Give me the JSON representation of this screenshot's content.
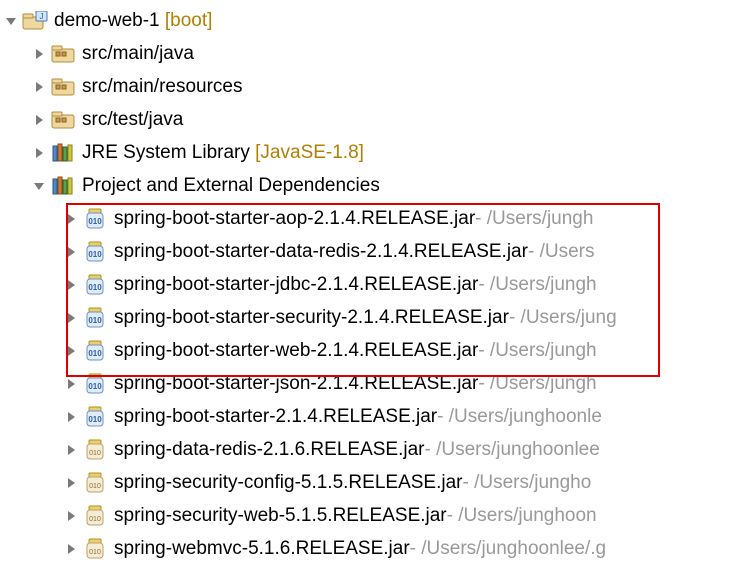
{
  "project": {
    "name": "demo-web-1",
    "qualifier": "[boot]"
  },
  "folders": [
    {
      "label": "src/main/java"
    },
    {
      "label": "src/main/resources"
    },
    {
      "label": "src/test/java"
    }
  ],
  "jre": {
    "label": "JRE System Library",
    "qualifier": "[JavaSE-1.8]"
  },
  "deps_label": "Project and External Dependencies",
  "jars": [
    {
      "name": "spring-boot-starter-aop-2.1.4.RELEASE.jar",
      "path": " - /Users/jungh",
      "jar_type": "blue"
    },
    {
      "name": "spring-boot-starter-data-redis-2.1.4.RELEASE.jar",
      "path": " - /Users",
      "jar_type": "blue"
    },
    {
      "name": "spring-boot-starter-jdbc-2.1.4.RELEASE.jar",
      "path": " - /Users/jungh",
      "jar_type": "blue"
    },
    {
      "name": "spring-boot-starter-security-2.1.4.RELEASE.jar",
      "path": " - /Users/jung",
      "jar_type": "blue"
    },
    {
      "name": "spring-boot-starter-web-2.1.4.RELEASE.jar",
      "path": " - /Users/jungh",
      "jar_type": "blue"
    },
    {
      "name": "spring-boot-starter-json-2.1.4.RELEASE.jar",
      "path": " - /Users/jungh",
      "jar_type": "blue"
    },
    {
      "name": "spring-boot-starter-2.1.4.RELEASE.jar",
      "path": " - /Users/junghoonle",
      "jar_type": "blue"
    },
    {
      "name": "spring-data-redis-2.1.6.RELEASE.jar",
      "path": " - /Users/junghoonlee",
      "jar_type": "plain"
    },
    {
      "name": "spring-security-config-5.1.5.RELEASE.jar",
      "path": " - /Users/jungho",
      "jar_type": "plain"
    },
    {
      "name": "spring-security-web-5.1.5.RELEASE.jar",
      "path": " - /Users/junghoon",
      "jar_type": "plain"
    },
    {
      "name": "spring-webmvc-5.1.6.RELEASE.jar",
      "path": " - /Users/junghoonlee/.g",
      "jar_type": "plain"
    }
  ]
}
